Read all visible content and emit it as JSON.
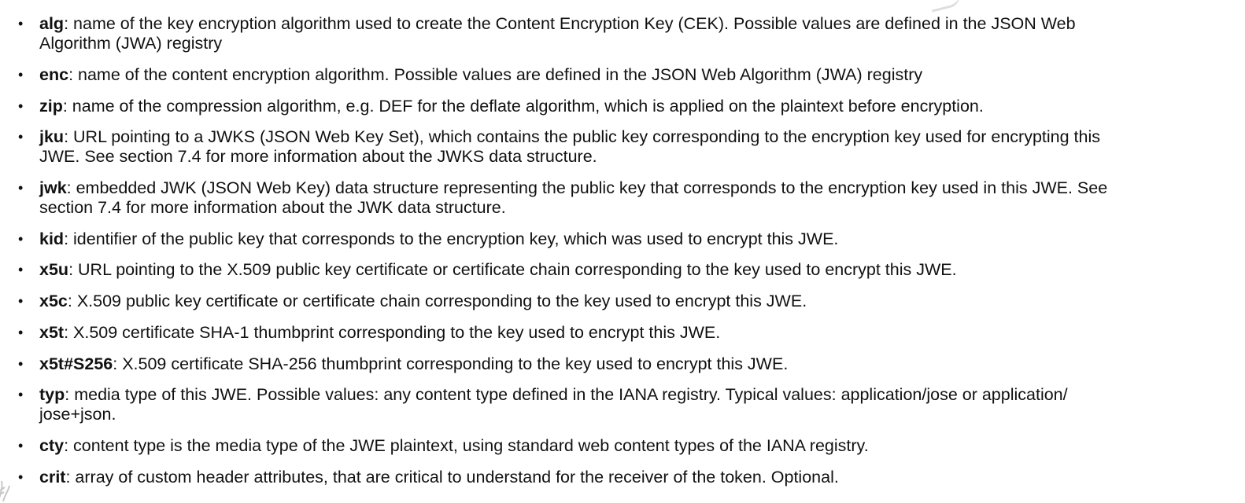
{
  "items": [
    {
      "key": "alg",
      "lines": [
        ": name of the key encryption algorithm used to create the Content Encryption Key (CEK). Possible values are defined in the JSON Web",
        "Algorithm (JWA) registry"
      ]
    },
    {
      "key": "enc",
      "lines": [
        ": name of the content encryption algorithm. Possible values are defined in the JSON Web Algorithm (JWA) registry"
      ]
    },
    {
      "key": "zip",
      "lines": [
        ": name of the compression algorithm, e.g. DEF for the deflate algorithm, which is applied on the plaintext before encryption."
      ]
    },
    {
      "key": "jku",
      "lines": [
        ": URL pointing to a JWKS (JSON Web Key Set), which contains the public key corresponding to the encryption key used for encrypting this",
        "JWE. See section 7.4 for more information about the JWKS data structure."
      ]
    },
    {
      "key": "jwk",
      "lines": [
        ": embedded JWK (JSON Web Key) data structure representing the public key that corresponds to the encryption key used in this JWE. See",
        "section 7.4 for more information about the JWK data structure."
      ]
    },
    {
      "key": "kid",
      "lines": [
        ": identifier of the public key that corresponds to the encryption key, which was used to encrypt this JWE."
      ]
    },
    {
      "key": "x5u",
      "lines": [
        ": URL pointing to the X.509 public key certificate or certificate chain corresponding to the key used to encrypt this JWE."
      ]
    },
    {
      "key": "x5c",
      "lines": [
        ": X.509 public key certificate or certificate chain corresponding to the key used to encrypt this JWE."
      ]
    },
    {
      "key": "x5t",
      "lines": [
        ": X.509 certificate SHA-1 thumbprint corresponding to the key used to encrypt this JWE."
      ]
    },
    {
      "key": "x5t#S256",
      "lines": [
        ": X.509 certificate SHA-256 thumbprint corresponding to the key used to encrypt this JWE."
      ]
    },
    {
      "key": "typ",
      "lines": [
        ": media type of this JWE. Possible values: any content type defined in the IANA registry. Typical values: application/jose or application/",
        "jose+json."
      ]
    },
    {
      "key": "cty",
      "lines": [
        ": content type is the media type of the JWE plaintext, using standard web content types of the IANA registry."
      ]
    },
    {
      "key": "crit",
      "lines": [
        ": array of custom header attributes, that are critical to understand for the receiver of the token. Optional."
      ]
    }
  ]
}
